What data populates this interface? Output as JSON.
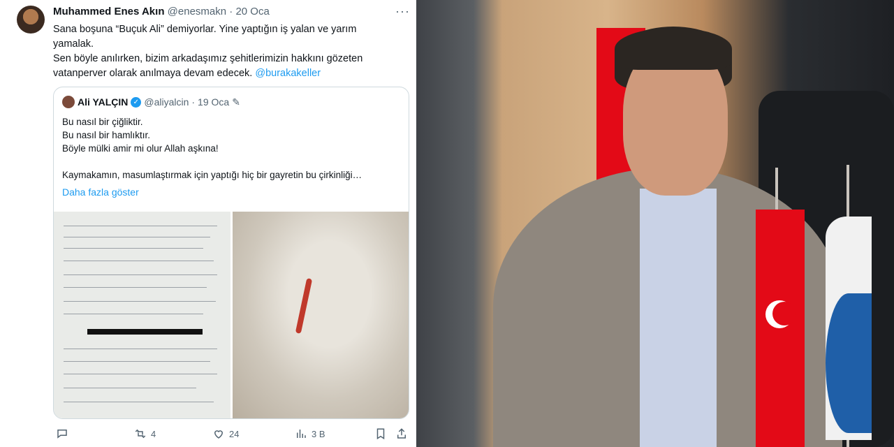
{
  "tweet": {
    "author_name": "Muhammed Enes Akın",
    "author_handle": "@enesmakn",
    "separator": "·",
    "date": "20 Oca",
    "more": "···",
    "lines": [
      "Sana boşuna “Buçuk Ali” demiyorlar. Yine yaptığın iş yalan ve yarım yamalak.",
      "Sen böyle anılırken, bizim arkadaşımız şehitlerimizin hakkını gözeten vatanperver olarak anılmaya devam edecek."
    ],
    "mention": "@burakakeller"
  },
  "quote": {
    "author_name": "Ali YALÇIN",
    "author_handle": "@aliyalcin",
    "date": "19 Oca",
    "lines": [
      "Bu nasıl bir çiğliktir.",
      "Bu nasıl bir hamlıktır.",
      "Böyle mülki amir mi olur Allah aşkına!",
      "",
      "Kaymakamın, masumlaştırmak için yaptığı hiç bir gayretin bu çirkinliği…"
    ],
    "show_more": "Daha fazla göster"
  },
  "actions": {
    "retweets": "4",
    "likes": "24",
    "views": "3 B"
  },
  "colors": {
    "link": "#1d9bf0",
    "muted": "#536471",
    "flag_red": "#e30a17"
  }
}
